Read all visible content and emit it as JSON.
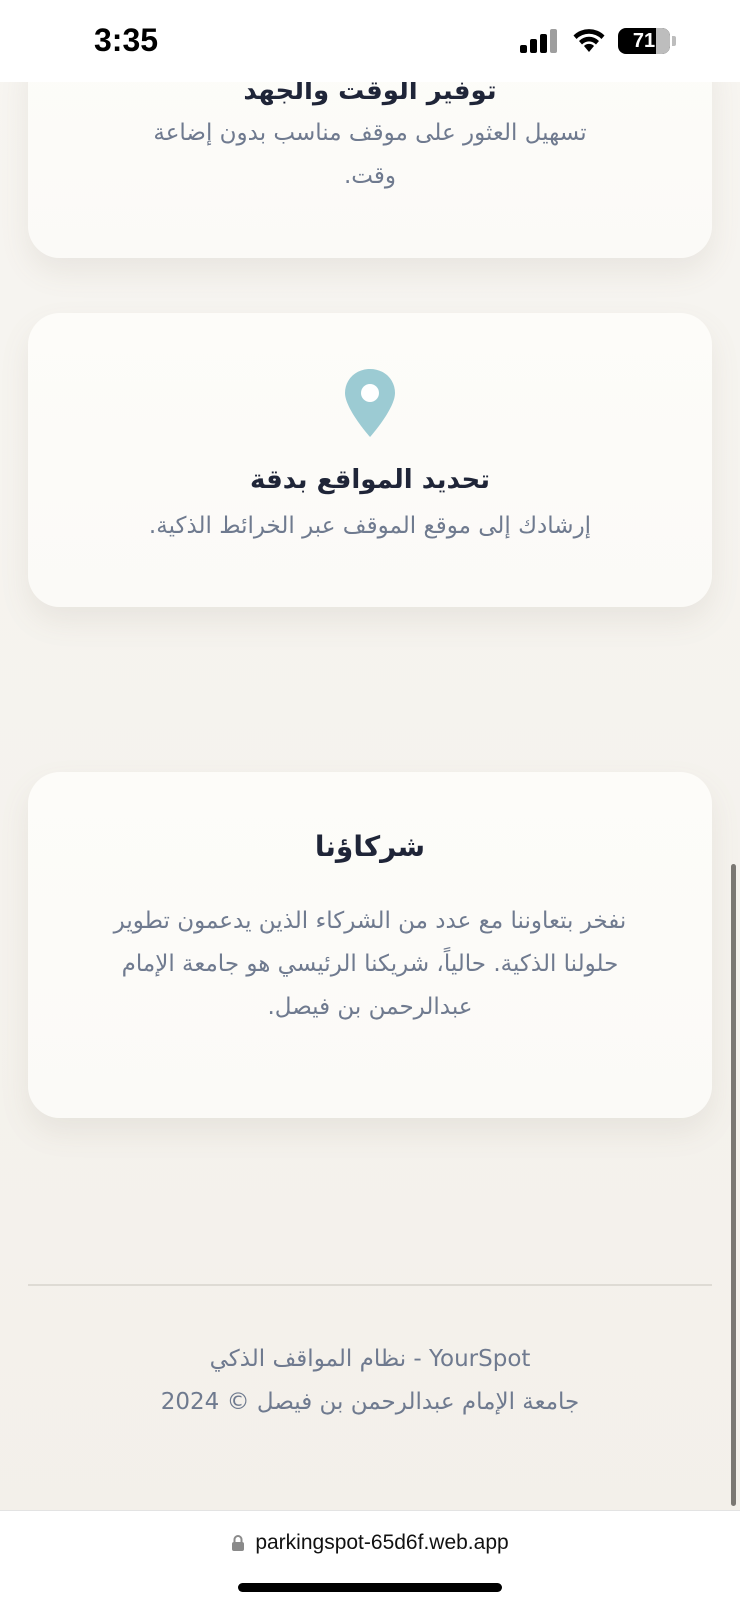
{
  "status_bar": {
    "time": "3:35",
    "battery": "71",
    "icons": [
      "cellular-signal-icon",
      "wifi-icon",
      "battery-icon"
    ]
  },
  "cards": [
    {
      "title": "توفير الوقت والجهد",
      "text": "تسهيل العثور على موقف مناسب بدون إضاعة وقت."
    },
    {
      "icon": "map-pin-icon",
      "icon_color": "#9ccbd3",
      "title": "تحديد المواقع بدقة",
      "text": "إرشادك إلى موقع الموقف عبر الخرائط الذكية."
    },
    {
      "title": "شركاؤنا",
      "text": "نفخر بتعاوننا مع عدد من الشركاء الذين يدعمون تطوير حلولنا الذكية. حالياً، شريكنا الرئيسي هو جامعة الإمام عبدالرحمن بن فيصل."
    }
  ],
  "footer": {
    "line1": "YourSpot - نظام المواقف الذكي",
    "line2": "جامعة الإمام عبدالرحمن بن فيصل © 2024"
  },
  "browser": {
    "url": "parkingspot-65d6f.web.app"
  },
  "colors": {
    "title": "#1f2538",
    "text": "#6f7a8f",
    "accent": "#9ccbd3",
    "background": "#f5f3ee"
  }
}
